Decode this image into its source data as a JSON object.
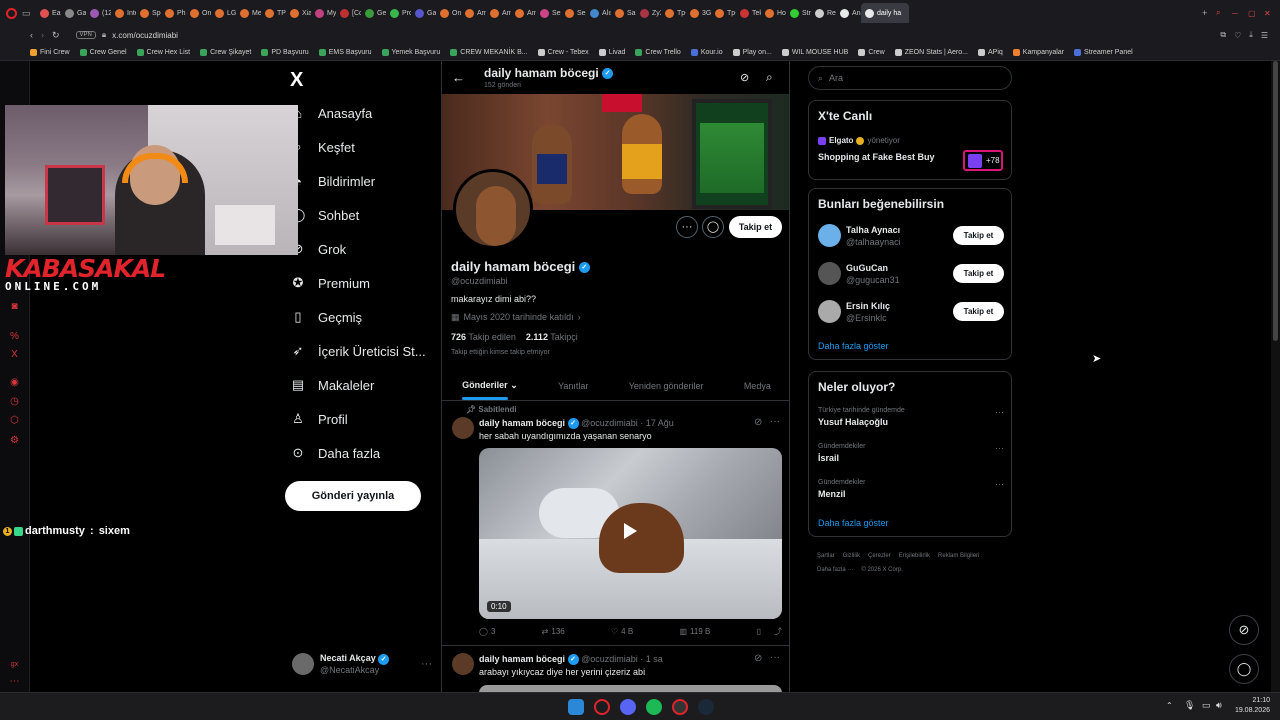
{
  "browser": {
    "tabs": [
      "Eas",
      "Gar",
      "(12)",
      "Inte",
      "Spo",
      "Phil",
      "Onu",
      "LG",
      "Me",
      "TP-",
      "Xia",
      "My",
      "[Co",
      "Gel",
      "Pro",
      "Gal",
      "Onl",
      "Am",
      "Am",
      "Am",
      "Sep",
      "Sep",
      "Alış",
      "San",
      "ZyX",
      "Tp-",
      "3G",
      "Tp-",
      "Tek",
      "Hot",
      "Str",
      "Rec",
      "Ana",
      "daily ha"
    ],
    "tab_colors": [
      "#e05050",
      "#888",
      "#9b59b6",
      "#e07030",
      "#e07030",
      "#e07030",
      "#e07030",
      "#e07030",
      "#e07030",
      "#e07030",
      "#e07030",
      "#c04080",
      "#c03030",
      "#3a9a3a",
      "#38b84a",
      "#5555cc",
      "#e07030",
      "#e07030",
      "#e07030",
      "#e07030",
      "#cc4488",
      "#e07030",
      "#4488cc",
      "#e07030",
      "#aa3344",
      "#e07030",
      "#e07030",
      "#e07030",
      "#cc3333",
      "#e07030",
      "#33cc33",
      "#cccccc",
      "#e7e9ea",
      "#e7e9ea"
    ],
    "url": "x.com/ocuzdimiabi",
    "vpn_label": "VPN",
    "bookmarks": [
      "Fini Crew",
      "Crew Genel",
      "Crew Hex List",
      "Crew Şikayet",
      "PD Başvuru",
      "EMS Başvuru",
      "Yemek Başvuru",
      "CREW MEKANİK B...",
      "Crew - Tebex",
      "Livad",
      "Crew Trello",
      "Kour.io",
      "Play on...",
      "WIL MOUSE HUB",
      "Crew",
      "ZEON Stats | Aero...",
      "APiq",
      "Kampanyalar",
      "Streamer Panel"
    ],
    "bookmark_colors": [
      "#f0a030",
      "#3aa55a",
      "#3aa55a",
      "#3aa55a",
      "#3aa55a",
      "#3aa55a",
      "#3aa55a",
      "#3aa55a",
      "#cccccc",
      "#cccccc",
      "#3aa55a",
      "#4a6fd8",
      "#cccccc",
      "#cccccc",
      "#cccccc",
      "#cccccc",
      "#cccccc",
      "#f08030",
      "#4a6fd8"
    ]
  },
  "stream": {
    "brand_line1": "KABASAKAL",
    "brand_line2": "ONLINE.COM",
    "chat_user": "darthmusty",
    "chat_sep": " : ",
    "chat_text": "sixem"
  },
  "nav": {
    "logo": "X",
    "items": [
      {
        "label": "Anasayfa",
        "icon": "home-icon"
      },
      {
        "label": "Keşfet",
        "icon": "search-icon"
      },
      {
        "label": "Bildirimler",
        "icon": "bell-icon"
      },
      {
        "label": "Sohbet",
        "icon": "chat-icon"
      },
      {
        "label": "Grok",
        "icon": "grok-icon"
      },
      {
        "label": "Premium",
        "icon": "premium-icon"
      },
      {
        "label": "Geçmiş",
        "icon": "bookmark-icon"
      },
      {
        "label": "İçerik Üreticisi St...",
        "icon": "rocket-icon"
      },
      {
        "label": "Makaleler",
        "icon": "article-icon"
      },
      {
        "label": "Profil",
        "icon": "person-icon"
      },
      {
        "label": "Daha fazla",
        "icon": "more-circle-icon"
      }
    ],
    "post_button": "Gönderi yayınla",
    "account": {
      "name": "Necati Akçay",
      "handle": "@NecatiAkcay"
    }
  },
  "profile": {
    "header_name": "daily hamam böcegi",
    "post_count": "152 gönderi",
    "name": "daily hamam böcegi",
    "handle": "@ocuzdimiabi",
    "bio": "makarayız dimi abi??",
    "joined": "Mayıs 2020 tarihinde katıldı",
    "following_count": "726",
    "following_label": "Takip edilen",
    "followers_count": "2.112",
    "followers_label": "Takipçi",
    "followed_by": "Takip ettiğin kimse takip etmiyor",
    "follow_button": "Takip et",
    "tabs": [
      "Gönderiler",
      "Yanıtlar",
      "Yeniden gönderiler",
      "Medya"
    ]
  },
  "tweets": [
    {
      "pinned": "Sabitlendi",
      "name": "daily hamam böcegi",
      "handle": "@ocuzdimiabi",
      "time": "· 17 Ağu",
      "text": "her sabah uyandıgımızda yaşanan senaryo",
      "video_duration": "0:10",
      "replies": "3",
      "reposts": "136",
      "likes": "4 B",
      "views": "119 B"
    },
    {
      "name": "daily hamam böcegi",
      "handle": "@ocuzdimiabi",
      "time": "· 1 sa",
      "text": "arabayı yıkıycaz diye her yerini çizeriz abi"
    }
  ],
  "sidebar": {
    "search_placeholder": "Ara",
    "live": {
      "title": "X'te Canlı",
      "host": "Elgato",
      "host_suffix": "yönetiyor",
      "space_title": "Shopping at Fake Best Buy",
      "listeners": "+78"
    },
    "suggestions": {
      "title": "Bunları beğenebilirsin",
      "users": [
        {
          "name": "Talha Aynacı",
          "handle": "@talhaaynaci",
          "button": "Takip et",
          "color": "#6bb0e8"
        },
        {
          "name": "GuGuCan",
          "handle": "@gugucan31",
          "button": "Takip et",
          "color": "#555555"
        },
        {
          "name": "Ersin Kılıç",
          "handle": "@Ersinklc",
          "button": "Takip et",
          "color": "#aaaaaa"
        }
      ],
      "more": "Daha fazla göster"
    },
    "trends": {
      "title": "Neler oluyor?",
      "items": [
        {
          "context": "Türkiye tarihinde gündemde",
          "topic": "Yusuf Halaçoğlu"
        },
        {
          "context": "Gündemdekiler",
          "topic": "İsrail"
        },
        {
          "context": "Gündemdekiler",
          "topic": "Menzil"
        }
      ],
      "more": "Daha fazla göster"
    },
    "footer": [
      "Şartlar",
      "Gizlilik",
      "Çerezler",
      "Erişilebilirlik",
      "Reklam Bilgileri",
      "Daha fazla ···",
      "© 2026 X Corp."
    ]
  },
  "clock": {
    "time": "21:10",
    "date": "19.08.2026"
  }
}
